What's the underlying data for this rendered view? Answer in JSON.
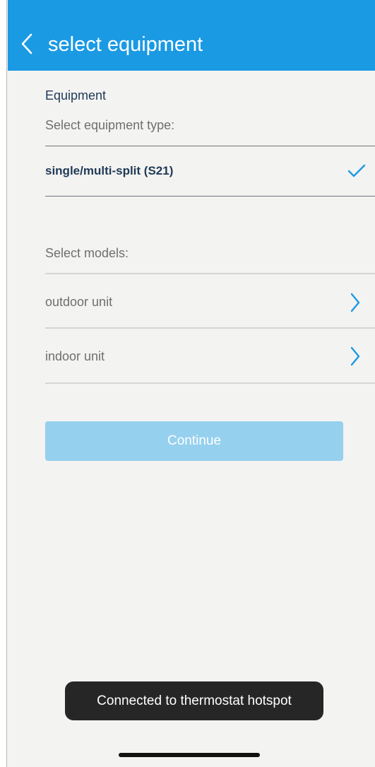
{
  "header": {
    "back_icon": "chevron-left-icon",
    "title": "select equipment"
  },
  "equipment": {
    "section_label": "Equipment",
    "type_prompt": "Select equipment type:",
    "selected_type": "single/multi-split (S21)",
    "selected_icon": "checkmark-icon"
  },
  "models": {
    "prompt": "Select models:",
    "items": [
      {
        "label": "outdoor unit",
        "icon": "chevron-right-icon"
      },
      {
        "label": "indoor unit",
        "icon": "chevron-right-icon"
      }
    ]
  },
  "actions": {
    "continue_label": "Continue"
  },
  "toast": {
    "message": "Connected to thermostat hotspot"
  },
  "colors": {
    "header": "#1b9ae4",
    "accent": "#1b9ae4",
    "continue_disabled": "#95d0ee",
    "toast_background": "#262626"
  }
}
